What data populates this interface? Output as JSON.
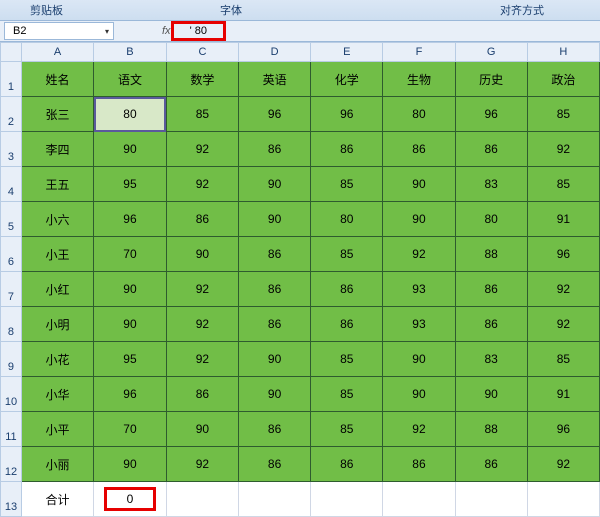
{
  "ribbon": {
    "group_clipboard": "剪贴板",
    "group_font": "字体",
    "group_align": "对齐方式"
  },
  "formula_bar": {
    "name_box": "B2",
    "fx": "fx",
    "value": "' 80"
  },
  "columns": [
    "A",
    "B",
    "C",
    "D",
    "E",
    "F",
    "G",
    "H"
  ],
  "rows": [
    "1",
    "2",
    "3",
    "4",
    "5",
    "6",
    "7",
    "8",
    "9",
    "10",
    "11",
    "12",
    "13"
  ],
  "headers": [
    "姓名",
    "语文",
    "数学",
    "英语",
    "化学",
    "生物",
    "历史",
    "政治"
  ],
  "data": [
    [
      "张三",
      "80",
      "85",
      "96",
      "96",
      "80",
      "96",
      "85"
    ],
    [
      "李四",
      "90",
      "92",
      "86",
      "86",
      "86",
      "86",
      "92"
    ],
    [
      "王五",
      "95",
      "92",
      "90",
      "85",
      "90",
      "83",
      "85"
    ],
    [
      "小六",
      "96",
      "86",
      "90",
      "80",
      "90",
      "80",
      "91"
    ],
    [
      "小王",
      "70",
      "90",
      "86",
      "85",
      "92",
      "88",
      "96"
    ],
    [
      "小红",
      "90",
      "92",
      "86",
      "86",
      "93",
      "86",
      "92"
    ],
    [
      "小明",
      "90",
      "92",
      "86",
      "86",
      "93",
      "86",
      "92"
    ],
    [
      "小花",
      "95",
      "92",
      "90",
      "85",
      "90",
      "83",
      "85"
    ],
    [
      "小华",
      "96",
      "86",
      "90",
      "85",
      "90",
      "90",
      "91"
    ],
    [
      "小平",
      "70",
      "90",
      "86",
      "85",
      "92",
      "88",
      "96"
    ],
    [
      "小丽",
      "90",
      "92",
      "86",
      "86",
      "86",
      "86",
      "92"
    ]
  ],
  "total_row": {
    "label": "合计",
    "value": "0"
  },
  "chart_data": {
    "type": "table",
    "title": "",
    "columns": [
      "姓名",
      "语文",
      "数学",
      "英语",
      "化学",
      "生物",
      "历史",
      "政治"
    ],
    "rows": [
      {
        "姓名": "张三",
        "语文": 80,
        "数学": 85,
        "英语": 96,
        "化学": 96,
        "生物": 80,
        "历史": 96,
        "政治": 85
      },
      {
        "姓名": "李四",
        "语文": 90,
        "数学": 92,
        "英语": 86,
        "化学": 86,
        "生物": 86,
        "历史": 86,
        "政治": 92
      },
      {
        "姓名": "王五",
        "语文": 95,
        "数学": 92,
        "英语": 90,
        "化学": 85,
        "生物": 90,
        "历史": 83,
        "政治": 85
      },
      {
        "姓名": "小六",
        "语文": 96,
        "数学": 86,
        "英语": 90,
        "化学": 80,
        "生物": 90,
        "历史": 80,
        "政治": 91
      },
      {
        "姓名": "小王",
        "语文": 70,
        "数学": 90,
        "英语": 86,
        "化学": 85,
        "生物": 92,
        "历史": 88,
        "政治": 96
      },
      {
        "姓名": "小红",
        "语文": 90,
        "数学": 92,
        "英语": 86,
        "化学": 86,
        "生物": 93,
        "历史": 86,
        "政治": 92
      },
      {
        "姓名": "小明",
        "语文": 90,
        "数学": 92,
        "英语": 86,
        "化学": 86,
        "生物": 93,
        "历史": 86,
        "政治": 92
      },
      {
        "姓名": "小花",
        "语文": 95,
        "数学": 92,
        "英语": 90,
        "化学": 85,
        "生物": 90,
        "历史": 83,
        "政治": 85
      },
      {
        "姓名": "小华",
        "语文": 96,
        "数学": 86,
        "英语": 90,
        "化学": 85,
        "生物": 90,
        "历史": 90,
        "政治": 91
      },
      {
        "姓名": "小平",
        "语文": 70,
        "数学": 90,
        "英语": 86,
        "化学": 85,
        "生物": 92,
        "历史": 88,
        "政治": 96
      },
      {
        "姓名": "小丽",
        "语文": 90,
        "数学": 92,
        "英语": 86,
        "化学": 86,
        "生物": 86,
        "历史": 86,
        "政治": 92
      }
    ],
    "total": {
      "label": "合计",
      "语文": 0
    }
  }
}
